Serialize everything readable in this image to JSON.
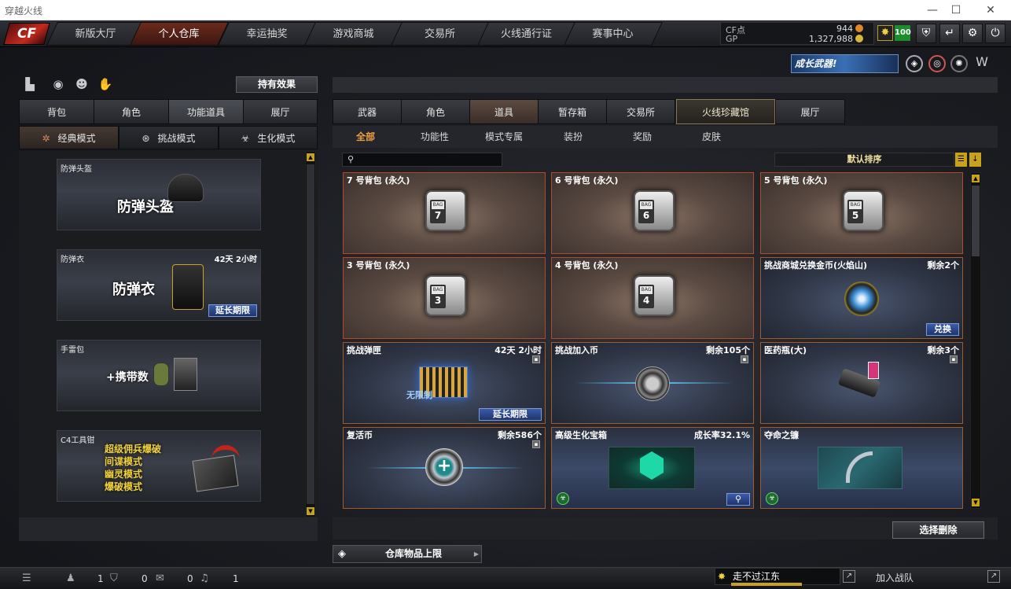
{
  "window": {
    "title": "穿越火线",
    "controls": [
      "—",
      "☐",
      "✕"
    ]
  },
  "logo": {
    "text": "CF"
  },
  "nav": {
    "tabs": [
      "新版大厅",
      "个人仓库",
      "幸运抽奖",
      "游戏商城",
      "交易所",
      "火线通行证",
      "赛事中心"
    ],
    "active_index": 1
  },
  "currency": {
    "cf_label": "CF点",
    "cf_value": "944",
    "gp_label": "GP",
    "gp_value": "1,327,988"
  },
  "top_right": {
    "badge_value": "100",
    "banner_text": "成长武器!"
  },
  "left": {
    "hold_effect_label": "持有效果",
    "tabs": [
      "背包",
      "角色",
      "功能道具",
      "展厅"
    ],
    "tab_active_index": 2,
    "modes": [
      "经典模式",
      "挑战模式",
      "生化模式"
    ],
    "mode_active_index": 0,
    "slots": [
      {
        "name": "防弹头盔",
        "big": "防弹头盔",
        "time": "",
        "action": ""
      },
      {
        "name": "防弹衣",
        "big": "防弹衣",
        "time": "42天 2小时",
        "action": "延长期限"
      },
      {
        "name": "手雷包",
        "big": "+携带数",
        "time": "",
        "action": ""
      },
      {
        "name": "C4工具钳",
        "lines": [
          "超级佣兵爆破",
          "间谍模式",
          "幽灵模式",
          "爆破模式"
        ],
        "time": "",
        "action": ""
      }
    ]
  },
  "right": {
    "tabs": [
      "武器",
      "角色",
      "道具",
      "暂存箱",
      "交易所",
      "火线珍藏馆",
      "展厅"
    ],
    "tab_active_index": 2,
    "subtabs": [
      "全部",
      "功能性",
      "模式专属",
      "装扮",
      "奖励",
      "皮肤"
    ],
    "subtab_active_index": 0,
    "search_placeholder": "",
    "sort_label": "默认排序",
    "cards": [
      {
        "name": "7 号背包 (永久)",
        "right": "",
        "bag": "7",
        "style": "bag"
      },
      {
        "name": "6 号背包 (永久)",
        "right": "",
        "bag": "6",
        "style": "bag"
      },
      {
        "name": "5 号背包 (永久)",
        "right": "",
        "bag": "5",
        "style": "bag"
      },
      {
        "name": "3 号背包 (永久)",
        "right": "",
        "bag": "3",
        "style": "bag"
      },
      {
        "name": "4 号背包 (永久)",
        "right": "",
        "bag": "4",
        "style": "bag"
      },
      {
        "name": "挑战商城兑换金币(火焰山)",
        "right": "剩余2个",
        "action": "兑换",
        "style": "blue"
      },
      {
        "name": "挑战弹匣",
        "right": "42天 2小时",
        "action": "延长期限",
        "img_text": "无限制",
        "style": "blue"
      },
      {
        "name": "挑战加入币",
        "right": "剩余105个",
        "style": "blue"
      },
      {
        "name": "医药瓶(大)",
        "right": "剩余3个",
        "style": "blue"
      },
      {
        "name": "复活币",
        "right": "剩余586个",
        "style": "blue"
      },
      {
        "name": "高级生化宝箱",
        "right": "成长率32.1%",
        "style": "blue2"
      },
      {
        "name": "夺命之镰",
        "right": "",
        "style": "blue2"
      }
    ],
    "delete_button": "选择删除",
    "capacity_label": "仓库物品上限"
  },
  "bottom": {
    "friends": "1",
    "shield": "0",
    "chat": "0",
    "sound": "1",
    "ticker": "走不过江东",
    "join": "加入战队"
  },
  "colors": {
    "accent": "#f0a040",
    "border": "#b24a24",
    "button": "#3b5aa8",
    "gold": "#c7a21d"
  }
}
